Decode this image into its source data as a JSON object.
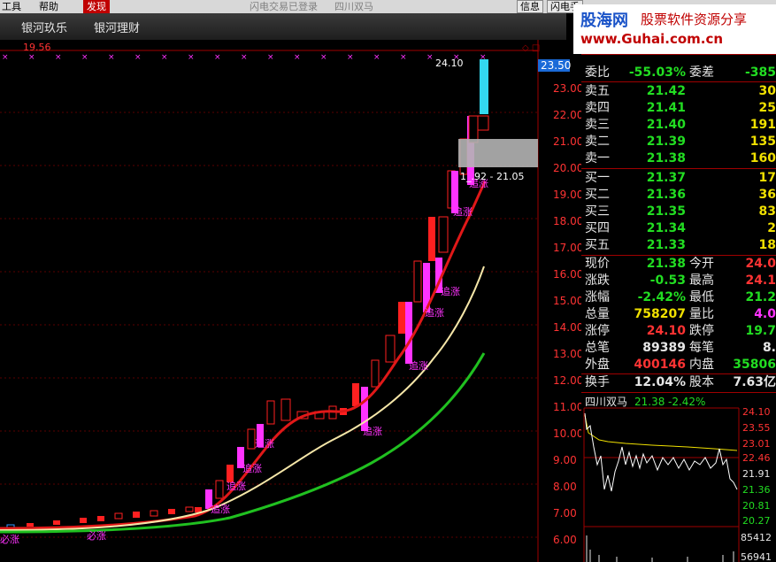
{
  "menu": {
    "tools": "工具",
    "help": "帮助",
    "discover": "发现",
    "status_login": "闪电交易已登录",
    "stock_name": "四川双马",
    "info": "信息",
    "flash": "闪电手"
  },
  "toolbar": {
    "item1": "银河玖乐",
    "item2": "银河理财"
  },
  "watermark": {
    "brand": "股海网",
    "slogan": "股票软件资源分享",
    "url": "www.Guhai.com.cn"
  },
  "chart": {
    "top_left_price": "19.56",
    "high_label": "24.10",
    "box_label": "1_.92 - 21.05",
    "current_price_tag": "23.50",
    "signal_zt": "追涨",
    "signal_bz": "必涨",
    "colors": {
      "up": "#ff2020",
      "signal": "#ff33ff",
      "ma_red": "#e01818",
      "ma_yellow": "#f5e6a8",
      "ma_green": "#20c020",
      "limit": "#33d8f0"
    }
  },
  "price_axis": [
    "23.00",
    "22.00",
    "21.00",
    "20.00",
    "19.00",
    "18.00",
    "17.00",
    "16.00",
    "15.00",
    "14.00",
    "13.00",
    "12.00",
    "11.00",
    "10.00",
    "9.00",
    "8.00",
    "7.00",
    "6.00"
  ],
  "quote": {
    "stock_header": "四川双马",
    "weibi": {
      "label": "委比",
      "value": "-55.03%",
      "label2": "委差",
      "value2": "-385"
    },
    "asks": [
      {
        "label": "卖五",
        "price": "21.42",
        "vol": "30"
      },
      {
        "label": "卖四",
        "price": "21.41",
        "vol": "25"
      },
      {
        "label": "卖三",
        "price": "21.40",
        "vol": "191"
      },
      {
        "label": "卖二",
        "price": "21.39",
        "vol": "135"
      },
      {
        "label": "卖一",
        "price": "21.38",
        "vol": "160"
      }
    ],
    "bids": [
      {
        "label": "买一",
        "price": "21.37",
        "vol": "17"
      },
      {
        "label": "买二",
        "price": "21.36",
        "vol": "36"
      },
      {
        "label": "买三",
        "price": "21.35",
        "vol": "83"
      },
      {
        "label": "买四",
        "price": "21.34",
        "vol": "2"
      },
      {
        "label": "买五",
        "price": "21.33",
        "vol": "18"
      }
    ],
    "stats": [
      {
        "l1": "现价",
        "v1": "21.38",
        "l2": "今开",
        "v2": "24.0"
      },
      {
        "l1": "涨跌",
        "v1": "-0.53",
        "l2": "最高",
        "v2": "24.1"
      },
      {
        "l1": "涨幅",
        "v1": "-2.42%",
        "l2": "最低",
        "v2": "21.2"
      },
      {
        "l1": "总量",
        "v1": "758207",
        "l2": "量比",
        "v2": "4.0"
      },
      {
        "l1": "涨停",
        "v1": "24.10",
        "l2": "跌停",
        "v2": "19.7"
      },
      {
        "l1": "总笔",
        "v1": "89389",
        "l2": "每笔",
        "v2": "8."
      },
      {
        "l1": "外盘",
        "v1": "400146",
        "l2": "内盘",
        "v2": "35806"
      },
      {
        "l1": "换手",
        "v1": "12.04%",
        "l2": "股本",
        "v2": "7.63亿"
      }
    ]
  },
  "minute": {
    "name": "四川双马",
    "price": "21.38",
    "pct": "-2.42%",
    "axis": [
      "24.10",
      "23.55",
      "23.01",
      "22.46",
      "21.91",
      "21.36",
      "20.81",
      "20.27",
      "85412",
      "56941"
    ]
  }
}
